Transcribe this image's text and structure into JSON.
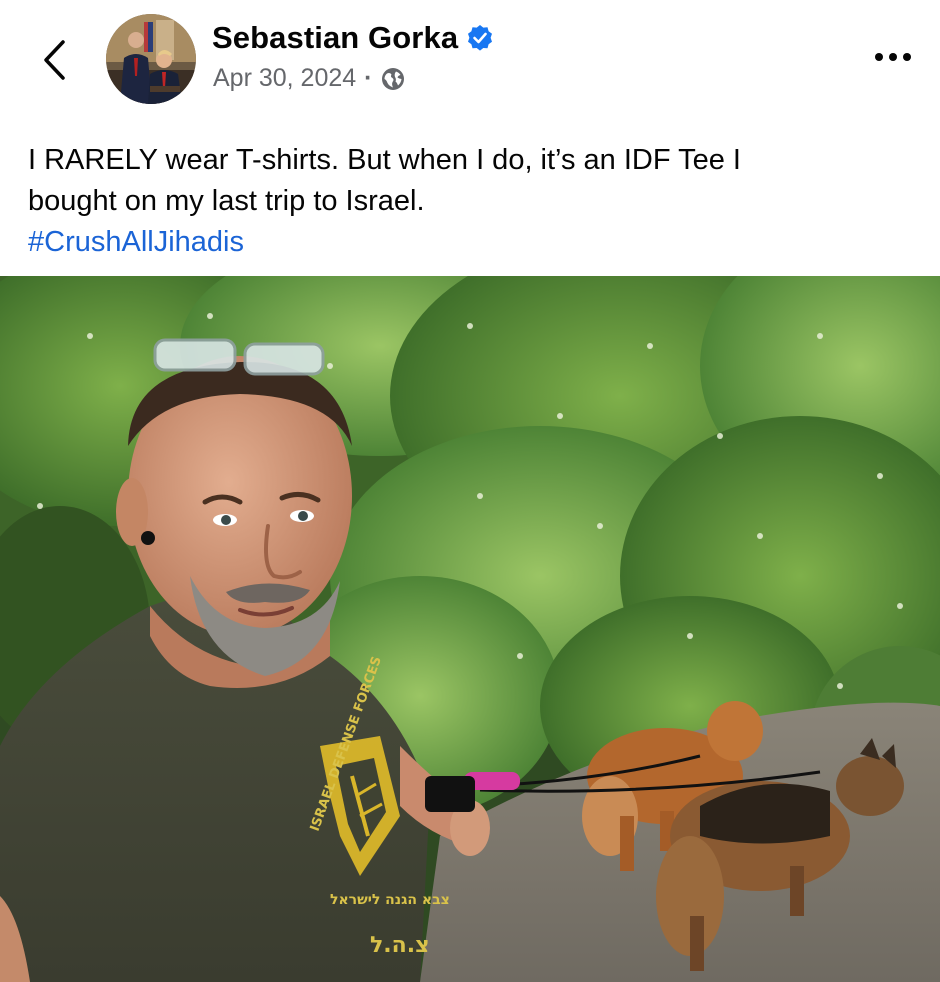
{
  "post": {
    "author_name": "Sebastian Gorka",
    "verified_icon": "verified-badge-icon",
    "date": "Apr 30, 2024",
    "separator": "·",
    "audience_icon": "globe-icon",
    "text_line1": "I RARELY wear T-shirts. But when I do, it’s an IDF Tee I",
    "text_line2": "bought on my last trip to Israel.",
    "hashtag": "#CrushAllJihadis"
  },
  "icons": {
    "back": "chevron-left-icon",
    "more": "more-options-icon"
  },
  "photo": {
    "shirt_print": "ISRAEL DEFENSE FORCES",
    "shirt_hebrew": "צבא הגנה לישראל",
    "shirt_abbr": "צ.ה.ל"
  },
  "colors": {
    "text": "#050505",
    "secondary": "#65676b",
    "link": "#1b64d6",
    "verified": "#1877f2"
  }
}
